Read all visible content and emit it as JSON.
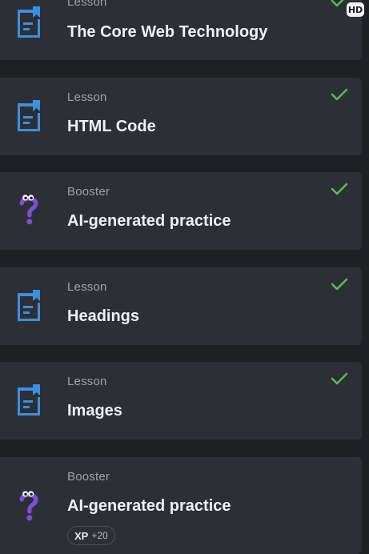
{
  "items": [
    {
      "type": "Lesson",
      "title": "The Core Web Technology",
      "icon": "lesson-icon",
      "completed": true
    },
    {
      "type": "Lesson",
      "title": "HTML Code",
      "icon": "lesson-icon",
      "completed": true
    },
    {
      "type": "Booster",
      "title": "AI-generated practice",
      "icon": "booster-question-icon",
      "completed": true
    },
    {
      "type": "Lesson",
      "title": "Headings",
      "icon": "lesson-icon",
      "completed": true
    },
    {
      "type": "Lesson",
      "title": "Images",
      "icon": "lesson-icon",
      "completed": true
    },
    {
      "type": "Booster",
      "title": "AI-generated practice",
      "icon": "booster-question-icon",
      "completed": false,
      "xp_label": "XP",
      "xp_value": "+20"
    }
  ],
  "badge": {
    "label": "HD"
  },
  "colors": {
    "background": "#1e2024",
    "card": "#2c2f35",
    "lesson_icon": "#3d8fe0",
    "booster_icon": "#7d4fd6",
    "check": "#5cb85c"
  }
}
